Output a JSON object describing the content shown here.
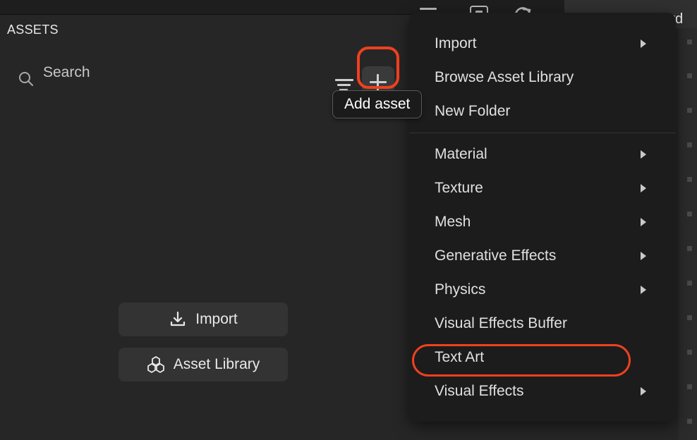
{
  "window": {
    "background_color": "#262626",
    "accent_highlight_color": "#f0401f"
  },
  "background_toolbar": {
    "icons": [
      {
        "name": "minimize-icon",
        "glyph": "dash"
      },
      {
        "name": "window-icon",
        "glyph": "rectangle"
      },
      {
        "name": "redo-icon",
        "glyph": "curved-arrow-right"
      }
    ],
    "reset_on_record_label": "Reset on Record"
  },
  "assets_panel": {
    "title": "ASSETS",
    "search": {
      "placeholder": "Search",
      "value": "",
      "icon": "search-icon"
    },
    "filter_button": {
      "icon": "filter-icon",
      "tooltip": ""
    },
    "add_button": {
      "icon": "plus-icon",
      "tooltip": "Add asset",
      "highlighted": true
    },
    "empty_state_actions": [
      {
        "label": "Import",
        "icon": "download-icon"
      },
      {
        "label": "Asset Library",
        "icon": "hexagons-icon"
      }
    ]
  },
  "context_menu": {
    "groups": [
      {
        "items": [
          {
            "label": "Import",
            "has_submenu": true
          },
          {
            "label": "Browse Asset Library",
            "has_submenu": false
          },
          {
            "label": "New Folder",
            "has_submenu": false
          }
        ]
      },
      {
        "items": [
          {
            "label": "Material",
            "has_submenu": true
          },
          {
            "label": "Texture",
            "has_submenu": true
          },
          {
            "label": "Mesh",
            "has_submenu": true
          },
          {
            "label": "Generative Effects",
            "has_submenu": true
          },
          {
            "label": "Physics",
            "has_submenu": true
          },
          {
            "label": "Visual Effects Buffer",
            "has_submenu": false
          },
          {
            "label": "Text Art",
            "has_submenu": false,
            "highlighted": true
          },
          {
            "label": "Visual Effects",
            "has_submenu": true
          }
        ]
      }
    ]
  }
}
